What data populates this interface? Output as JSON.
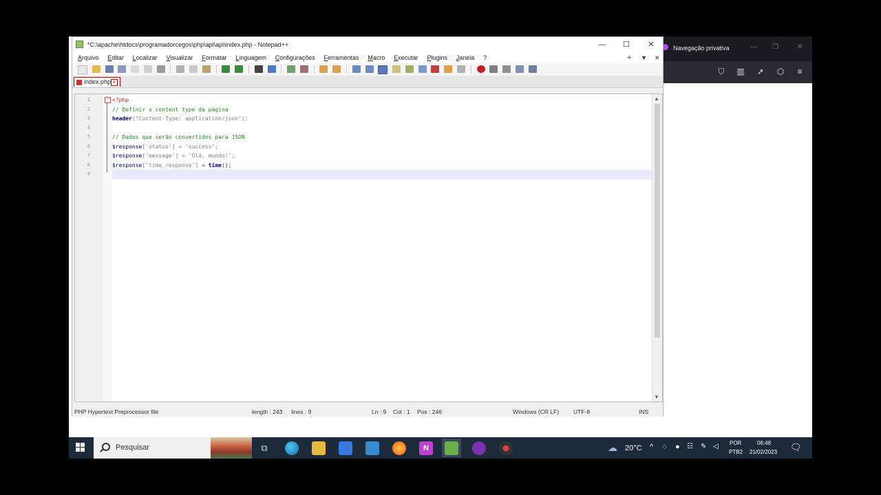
{
  "firefox": {
    "title": "Navegação privativa"
  },
  "notepad": {
    "title": "*C:\\apache\\htdocs\\programadorcegos\\php\\api\\api\\index.php - Notepad++",
    "menu": [
      "Arquivo",
      "Editar",
      "Localizar",
      "Visualizar",
      "Formatar",
      "Linguagem",
      "Configurações",
      "Ferramentas",
      "Macro",
      "Executar",
      "Plugins",
      "Janela",
      "?"
    ],
    "tab": {
      "label": "index.php"
    },
    "line_numbers": [
      "1",
      "2",
      "3",
      "4",
      "5",
      "6",
      "7",
      "8",
      "9"
    ],
    "code": {
      "l1_open": "<?php",
      "l2_comment": "// Definir o content type da página",
      "l3_func": "header",
      "l3_str": "(\"Content-Type: application/json\");",
      "l5_comment": "// Dados que serão convertidos para JSON",
      "l6_var": "$response",
      "l6_key": "['status']",
      "l6_rest": " = 'success';",
      "l7_var": "$response",
      "l7_key": "['message']",
      "l7_rest": " = 'Olá, mundo!';",
      "l8_var": "$response",
      "l8_key": "['time_response']",
      "l8_eq": " = ",
      "l8_func": "time",
      "l8_end": "();"
    },
    "status": {
      "filetype": "PHP Hypertext Preprocessor file",
      "length": "length : 243",
      "lines": "lines : 9",
      "ln": "Ln : 9",
      "col": "Col : 1",
      "pos": "Pos : 246",
      "eol": "Windows (CR LF)",
      "encoding": "UTF-8",
      "mode": "INS"
    }
  },
  "taskbar": {
    "search_placeholder": "Pesquisar",
    "weather": "20°C",
    "lang_top": "POR",
    "lang_bottom": "PTB2",
    "time": "06:48",
    "date": "21/02/2023"
  },
  "colors": {
    "comment": "#1e8a1e",
    "php_tag": "#e02020",
    "taskbar": "#1c2a3a",
    "firefox_dark": "#1c1b22"
  }
}
